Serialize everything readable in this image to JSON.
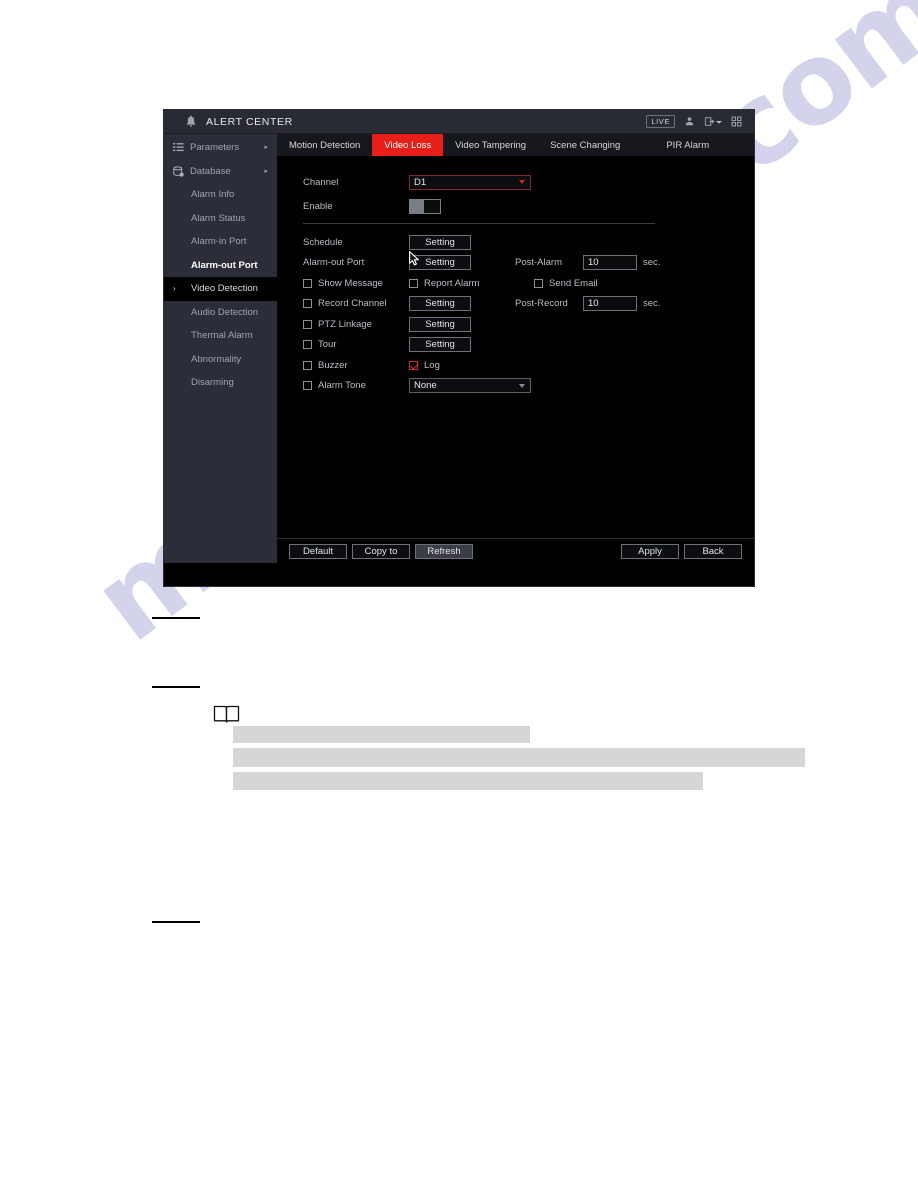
{
  "window": {
    "title": "ALERT CENTER",
    "bell_icon": "bell-icon",
    "live_badge": "LIVE",
    "user_icon": "user-icon",
    "logout_icon": "logout-icon",
    "apps_icon": "apps-grid-icon"
  },
  "sidebar": {
    "items": [
      {
        "label": "Parameters",
        "icon": "list-icon",
        "arrow": "▸",
        "state": "normal"
      },
      {
        "label": "Database",
        "icon": "database-icon",
        "arrow": "▸",
        "state": "normal"
      },
      {
        "label": "Alarm Info",
        "icon": "",
        "arrow": "",
        "state": "normal"
      },
      {
        "label": "Alarm Status",
        "icon": "",
        "arrow": "",
        "state": "normal"
      },
      {
        "label": "Alarm-in Port",
        "icon": "",
        "arrow": "",
        "state": "normal"
      },
      {
        "label": "Alarm-out Port",
        "icon": "",
        "arrow": "",
        "state": "selected"
      },
      {
        "label": "Video Detection",
        "icon": "",
        "arrow": "",
        "state": "active",
        "caret": "›"
      },
      {
        "label": "Audio Detection",
        "icon": "",
        "arrow": "",
        "state": "normal"
      },
      {
        "label": "Thermal Alarm",
        "icon": "",
        "arrow": "",
        "state": "normal"
      },
      {
        "label": "Abnormality",
        "icon": "",
        "arrow": "",
        "state": "normal"
      },
      {
        "label": "Disarming",
        "icon": "",
        "arrow": "",
        "state": "normal"
      }
    ]
  },
  "tabs": [
    {
      "label": "Motion Detection",
      "active": false
    },
    {
      "label": "Video Loss",
      "active": true
    },
    {
      "label": "Video Tampering",
      "active": false
    },
    {
      "label": "Scene Changing",
      "active": false
    },
    {
      "label": "PIR Alarm",
      "active": false
    }
  ],
  "form": {
    "channel_label": "Channel",
    "channel_value": "D1",
    "enable_label": "Enable",
    "enable_on": false,
    "schedule_label": "Schedule",
    "schedule_button": "Setting",
    "alarm_out_label": "Alarm-out Port",
    "alarm_out_button": "Setting",
    "post_alarm_label": "Post-Alarm",
    "post_alarm_value": "10",
    "post_alarm_unit": "sec.",
    "show_message_label": "Show Message",
    "show_message_checked": false,
    "report_alarm_label": "Report Alarm",
    "report_alarm_checked": false,
    "send_email_label": "Send Email",
    "send_email_checked": false,
    "record_channel_label": "Record Channel",
    "record_channel_checked": false,
    "record_channel_button": "Setting",
    "post_record_label": "Post-Record",
    "post_record_value": "10",
    "post_record_unit": "sec.",
    "ptz_linkage_label": "PTZ Linkage",
    "ptz_linkage_checked": false,
    "ptz_linkage_button": "Setting",
    "tour_label": "Tour",
    "tour_checked": false,
    "tour_button": "Setting",
    "buzzer_label": "Buzzer",
    "buzzer_checked": false,
    "log_label": "Log",
    "log_checked": true,
    "alarm_tone_label": "Alarm Tone",
    "alarm_tone_checked": false,
    "alarm_tone_value": "None"
  },
  "footer": {
    "default_label": "Default",
    "copy_to_label": "Copy to",
    "refresh_label": "Refresh",
    "apply_label": "Apply",
    "back_label": "Back"
  },
  "page": {
    "watermark": "manualslive.com",
    "note_icon": "book-icon"
  },
  "colors": {
    "accent_red": "#e61f19",
    "check_red": "#cf2a22",
    "sidebar_bg": "#2b2e38",
    "titlebar_bg": "#282b33",
    "content_bg": "#000000",
    "redaction_gray": "#d6d6d6"
  }
}
